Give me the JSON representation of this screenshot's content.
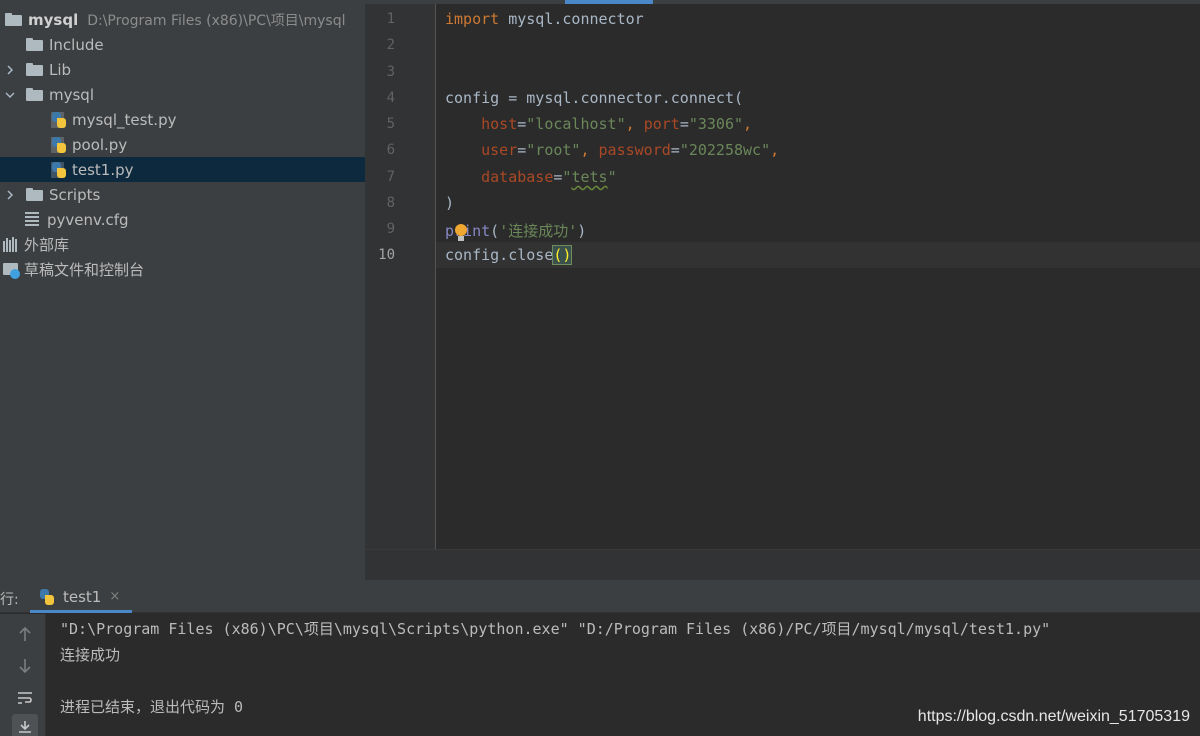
{
  "project_tree": {
    "root": {
      "name": "mysql",
      "path": "D:\\Program Files (x86)\\PC\\项目\\mysql"
    },
    "items": [
      {
        "label": "Include"
      },
      {
        "label": "Lib"
      },
      {
        "label": "mysql"
      },
      {
        "label": "mysql_test.py"
      },
      {
        "label": "pool.py"
      },
      {
        "label": "test1.py"
      },
      {
        "label": "Scripts"
      },
      {
        "label": "pyvenv.cfg"
      },
      {
        "label": "外部库"
      },
      {
        "label": "草稿文件和控制台"
      }
    ]
  },
  "editor": {
    "line_numbers": [
      "1",
      "2",
      "3",
      "4",
      "5",
      "6",
      "7",
      "8",
      "9",
      "10"
    ],
    "current_line": "10",
    "code": {
      "l1_kw": "import",
      "l1_mod": " mysql.connector",
      "l4": "config = mysql.connector.connect(",
      "l5_p1": "host",
      "l5_v1": "\"localhost\"",
      "l5_p2": "port",
      "l5_v2": "\"3306\"",
      "l6_p1": "user",
      "l6_v1": "\"root\"",
      "l6_p2": "password",
      "l6_v2": "\"202258wc\"",
      "l7_p1": "database",
      "l7_q1": "\"",
      "l7_v1": "tets",
      "l7_q2": "\"",
      "l8": ")",
      "l9_fn": "print",
      "l9_open": "(",
      "l9_str": "'连接成功'",
      "l9_close": ")",
      "l10": "config.close",
      "l10_paren": "()"
    }
  },
  "run_panel": {
    "label": "行:",
    "tab": "test1",
    "close_glyph": "×",
    "output": [
      "\"D:\\Program Files (x86)\\PC\\项目\\mysql\\Scripts\\python.exe\" \"D:/Program Files (x86)/PC/项目/mysql/mysql/test1.py\"",
      "连接成功",
      "",
      "进程已结束，退出代码为 0"
    ]
  },
  "watermark": "https://blog.csdn.net/weixin_51705319",
  "icons": [
    "folder-icon",
    "python-file-icon",
    "config-file-icon",
    "library-icon",
    "scratch-icon",
    "chevron-right-icon",
    "chevron-down-icon",
    "arrow-up-icon",
    "arrow-down-icon",
    "soft-wrap-icon",
    "scroll-to-end-icon",
    "lightbulb-icon"
  ],
  "colors": {
    "keyword": "#cc7832",
    "string": "#6a8759",
    "param": "#aa4926",
    "selection": "#0d293e",
    "accent": "#4a88c7"
  }
}
